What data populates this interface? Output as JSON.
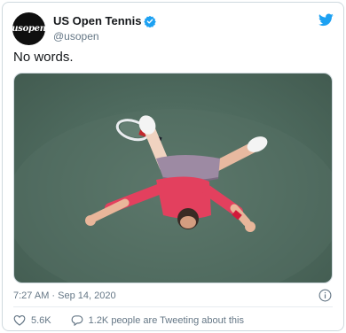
{
  "author": {
    "avatar_text": "usopen",
    "display_name": "US Open Tennis",
    "handle": "@usopen",
    "verified_icon": "verified-badge-icon",
    "brand_color": "#1da1f2"
  },
  "tweet": {
    "text": "No words.",
    "timestamp": "7:27 AM · Sep 14, 2020"
  },
  "engagement": {
    "likes": "5.6K",
    "tweeting_about": "1.2K people are Tweeting about this"
  },
  "icons": {
    "bird": "twitter-bird-icon",
    "info": "info-icon",
    "heart": "heart-icon",
    "reply": "reply-icon"
  }
}
